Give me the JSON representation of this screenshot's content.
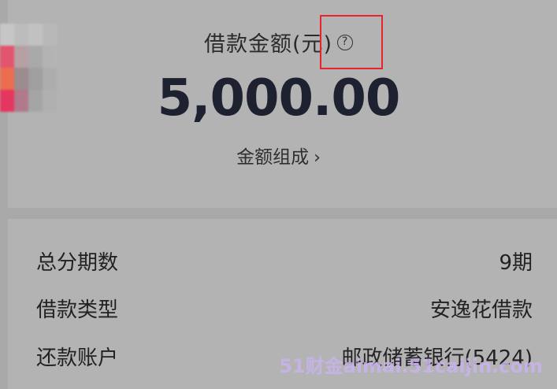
{
  "loan": {
    "amount_label": "借款金额(元)",
    "help_icon": "?",
    "amount_value": "5,000.00",
    "composition_link": "金额组成",
    "composition_chevron": "›"
  },
  "details": [
    {
      "label": "总分期数",
      "value": "9期"
    },
    {
      "label": "借款类型",
      "value": "安逸花借款"
    },
    {
      "label": "还款账户",
      "value": "邮政储蓄银行(5424)"
    }
  ],
  "watermark": "51财金aimai.51caijin.com",
  "colors": {
    "background": "#b3b3b3",
    "highlight": "#e8232b",
    "amount": "#1e2230",
    "watermark": "#c9b4f0"
  }
}
